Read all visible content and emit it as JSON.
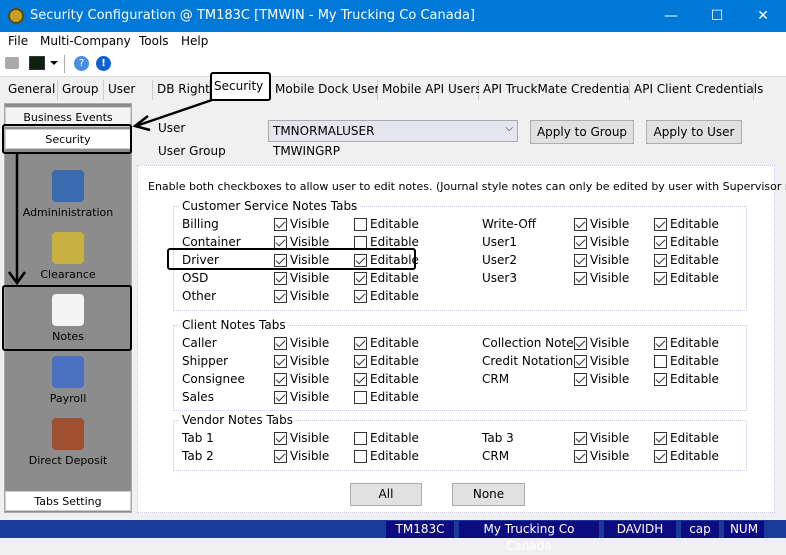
{
  "window": {
    "title": "Security Configuration @ TM183C [TMWIN - My Trucking Co Canada]"
  },
  "menu": [
    "File",
    "Multi-Company",
    "Tools",
    "Help"
  ],
  "tabs": [
    "General",
    "Group",
    "User",
    "DB Rights",
    "Security",
    "Mobile Dock Users",
    "Mobile API Users",
    "API TruckMate Credentials",
    "API Client Credentials"
  ],
  "active_tab": "Security",
  "left": {
    "header": "Business Events",
    "selected": "Security",
    "items": [
      "Admininistration",
      "Clearance",
      "Notes",
      "Payroll",
      "Direct Deposit"
    ],
    "footer": "Tabs Setting"
  },
  "user": {
    "label": "User",
    "value": "TMNORMALUSER",
    "group_label": "User Group",
    "group_value": "TMWINGRP",
    "apply_group": "Apply to Group",
    "apply_user": "Apply to User"
  },
  "instructions": "Enable both checkboxes to allow user to edit notes. (Journal style notes can only be edited by user with Supervisor rights)",
  "visible_label": "Visible",
  "editable_label": "Editable",
  "groups": [
    {
      "title": "Customer Service Notes Tabs",
      "left": [
        {
          "name": "Billing",
          "visible": true,
          "editable": false
        },
        {
          "name": "Container",
          "visible": true,
          "editable": false
        },
        {
          "name": "Driver",
          "visible": true,
          "editable": true
        },
        {
          "name": "OSD",
          "visible": true,
          "editable": true
        },
        {
          "name": "Other",
          "visible": true,
          "editable": true
        }
      ],
      "right": [
        {
          "name": "Write-Off",
          "visible": true,
          "editable": true
        },
        {
          "name": "User1",
          "visible": true,
          "editable": true
        },
        {
          "name": "User2",
          "visible": true,
          "editable": true
        },
        {
          "name": "User3",
          "visible": true,
          "editable": true
        }
      ]
    },
    {
      "title": "Client Notes Tabs",
      "left": [
        {
          "name": "Caller",
          "visible": true,
          "editable": true
        },
        {
          "name": "Shipper",
          "visible": true,
          "editable": true
        },
        {
          "name": "Consignee",
          "visible": true,
          "editable": true
        },
        {
          "name": "Sales",
          "visible": true,
          "editable": false
        }
      ],
      "right": [
        {
          "name": "Collection Notes",
          "visible": true,
          "editable": true
        },
        {
          "name": "Credit Notations",
          "visible": true,
          "editable": false
        },
        {
          "name": "CRM",
          "visible": true,
          "editable": true
        }
      ]
    },
    {
      "title": "Vendor Notes Tabs",
      "left": [
        {
          "name": "Tab 1",
          "visible": true,
          "editable": false
        },
        {
          "name": "Tab 2",
          "visible": true,
          "editable": false
        }
      ],
      "right": [
        {
          "name": "Tab 3",
          "visible": true,
          "editable": true
        },
        {
          "name": "CRM",
          "visible": true,
          "editable": true
        }
      ]
    }
  ],
  "buttons": {
    "all": "All",
    "none": "None"
  },
  "status": [
    "TM183C",
    "My Trucking Co Canada",
    "DAVIDH",
    "cap",
    "NUM"
  ]
}
